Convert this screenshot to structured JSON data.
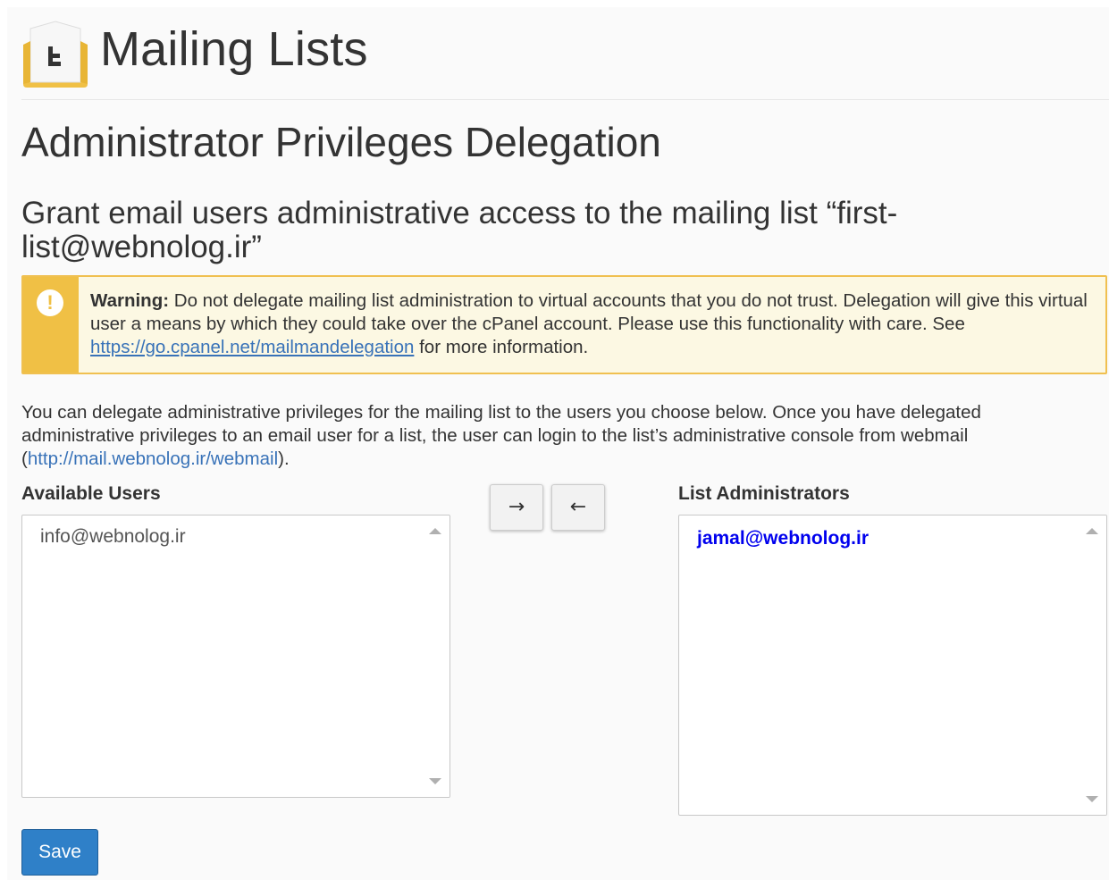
{
  "header": {
    "title": "Mailing Lists",
    "icon": "mailing-lists-icon"
  },
  "section_title": "Administrator Privileges Delegation",
  "subtitle": "Grant email users administrative access to the mailing list “first-list@webnolog.ir”",
  "warning": {
    "icon": "exclamation-icon",
    "label": "Warning:",
    "text_before_link": " Do not delegate mailing list administration to virtual accounts that you do not trust. Delegation will give this virtual user a means by which they could take over the cPanel account. Please use this functionality with care. See ",
    "link_text": "https://go.cpanel.net/mailmandelegation",
    "text_after_link": " for more information."
  },
  "intro": {
    "text_before_link": "You can delegate administrative privileges for the mailing list to the users you choose below. Once you have delegated administrative privileges to an email user for a list, the user can login to the list’s administrative console from webmail (",
    "link_text": "http://mail.webnolog.ir/webmail",
    "text_after_link": ")."
  },
  "available_users": {
    "label": "Available Users",
    "options": [
      "info@webnolog.ir"
    ]
  },
  "list_administrators": {
    "label": "List Administrators",
    "options": [
      "jamal@webnolog.ir"
    ]
  },
  "buttons": {
    "add": "→",
    "remove": "←",
    "save": "Save"
  },
  "colors": {
    "accent": "#2f80c8",
    "warning": "#f0c045",
    "admin_option": "#0000ee"
  }
}
